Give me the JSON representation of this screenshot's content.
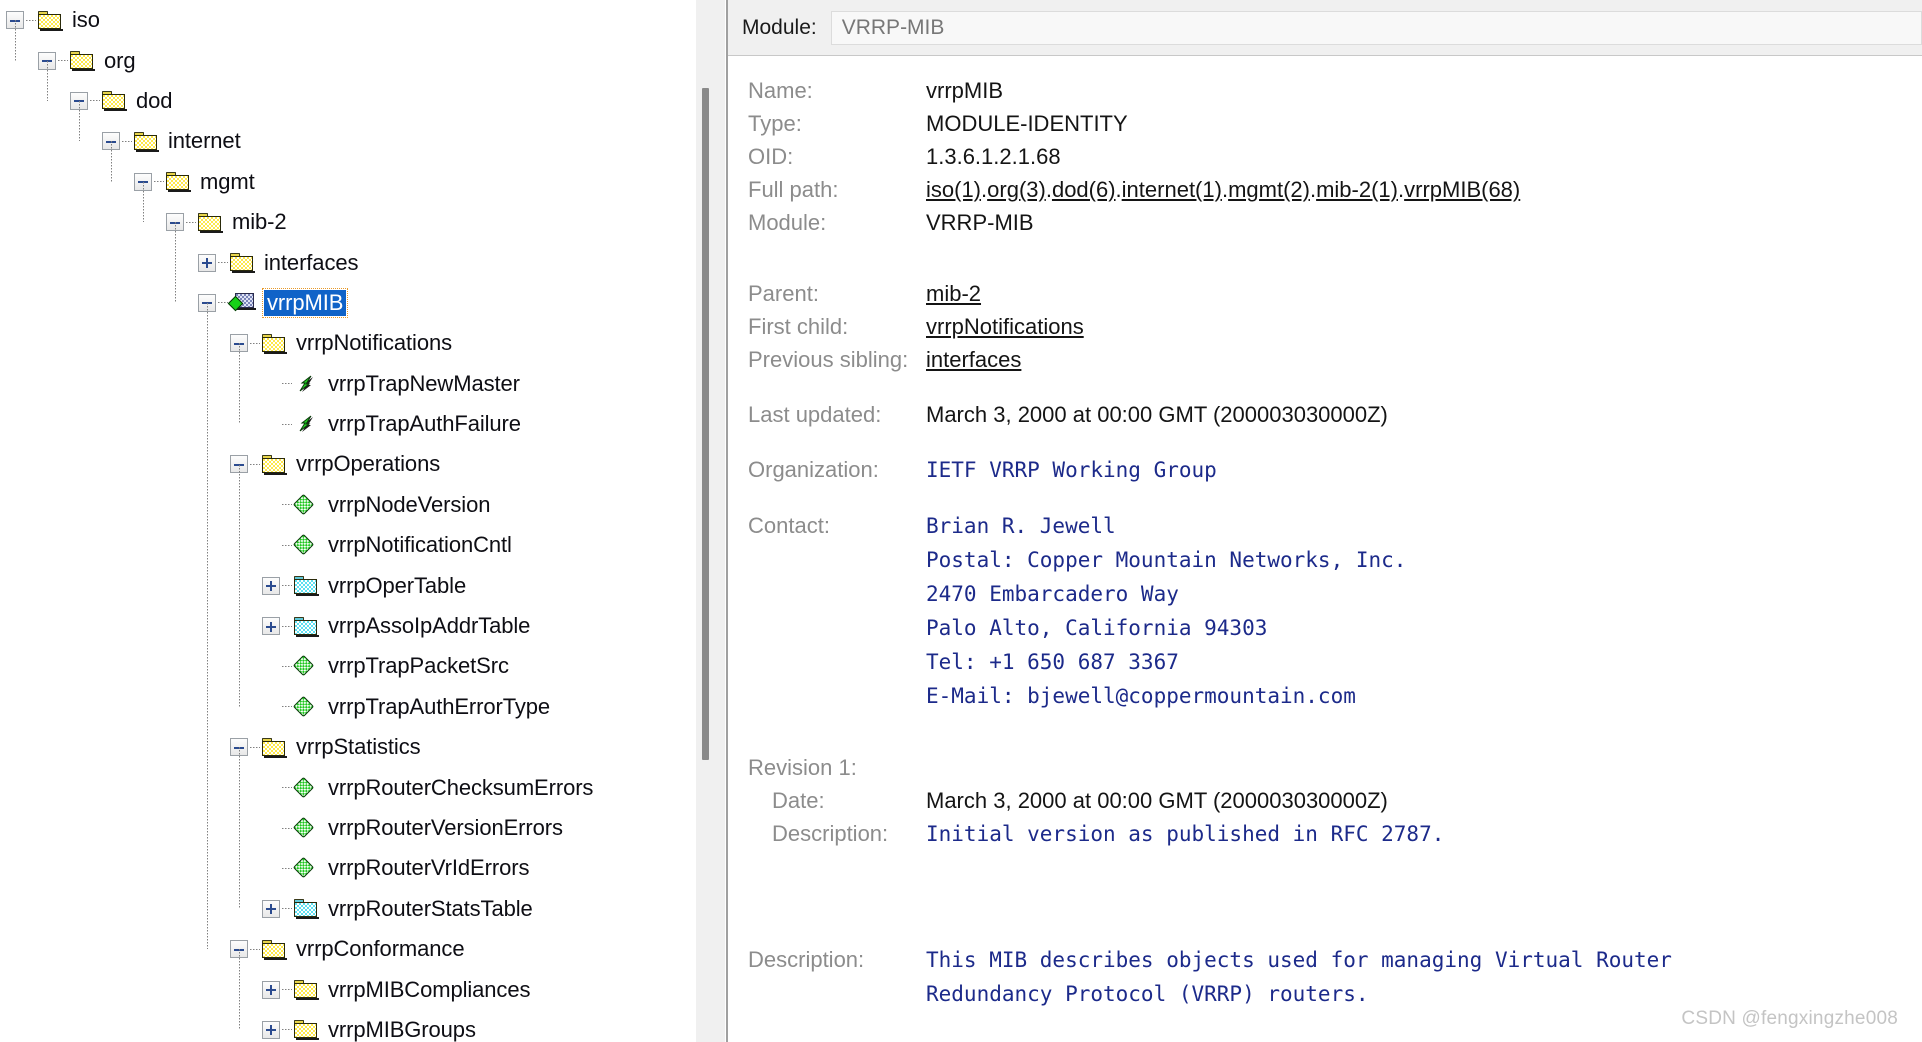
{
  "tree": {
    "nodes": [
      {
        "label": "iso",
        "depth": 0,
        "icon": "folder-yellow",
        "expander": "minus"
      },
      {
        "label": "org",
        "depth": 1,
        "icon": "folder-yellow",
        "expander": "minus"
      },
      {
        "label": "dod",
        "depth": 2,
        "icon": "folder-yellow",
        "expander": "minus"
      },
      {
        "label": "internet",
        "depth": 3,
        "icon": "folder-yellow",
        "expander": "minus"
      },
      {
        "label": "mgmt",
        "depth": 4,
        "icon": "folder-yellow",
        "expander": "minus"
      },
      {
        "label": "mib-2",
        "depth": 5,
        "icon": "folder-yellow",
        "expander": "minus"
      },
      {
        "label": "interfaces",
        "depth": 6,
        "icon": "folder-yellow",
        "expander": "plus"
      },
      {
        "label": "vrrpMIB",
        "depth": 6,
        "icon": "module",
        "expander": "minus",
        "selected": true
      },
      {
        "label": "vrrpNotifications",
        "depth": 7,
        "icon": "folder-yellow",
        "expander": "minus"
      },
      {
        "label": "vrrpTrapNewMaster",
        "depth": 8,
        "icon": "trap",
        "expander": "none"
      },
      {
        "label": "vrrpTrapAuthFailure",
        "depth": 8,
        "icon": "trap",
        "expander": "none"
      },
      {
        "label": "vrrpOperations",
        "depth": 7,
        "icon": "folder-yellow",
        "expander": "minus"
      },
      {
        "label": "vrrpNodeVersion",
        "depth": 8,
        "icon": "scalar",
        "expander": "none"
      },
      {
        "label": "vrrpNotificationCntl",
        "depth": 8,
        "icon": "scalar",
        "expander": "none"
      },
      {
        "label": "vrrpOperTable",
        "depth": 8,
        "icon": "folder-cyan",
        "expander": "plus"
      },
      {
        "label": "vrrpAssoIpAddrTable",
        "depth": 8,
        "icon": "folder-cyan",
        "expander": "plus"
      },
      {
        "label": "vrrpTrapPacketSrc",
        "depth": 8,
        "icon": "scalar",
        "expander": "none"
      },
      {
        "label": "vrrpTrapAuthErrorType",
        "depth": 8,
        "icon": "scalar",
        "expander": "none"
      },
      {
        "label": "vrrpStatistics",
        "depth": 7,
        "icon": "folder-yellow",
        "expander": "minus"
      },
      {
        "label": "vrrpRouterChecksumErrors",
        "depth": 8,
        "icon": "scalar",
        "expander": "none"
      },
      {
        "label": "vrrpRouterVersionErrors",
        "depth": 8,
        "icon": "scalar",
        "expander": "none"
      },
      {
        "label": "vrrpRouterVrIdErrors",
        "depth": 8,
        "icon": "scalar",
        "expander": "none"
      },
      {
        "label": "vrrpRouterStatsTable",
        "depth": 8,
        "icon": "folder-cyan",
        "expander": "plus"
      },
      {
        "label": "vrrpConformance",
        "depth": 7,
        "icon": "folder-yellow",
        "expander": "minus"
      },
      {
        "label": "vrrpMIBCompliances",
        "depth": 8,
        "icon": "folder-yellow",
        "expander": "plus"
      },
      {
        "label": "vrrpMIBGroups",
        "depth": 8,
        "icon": "folder-yellow",
        "expander": "plus"
      }
    ]
  },
  "detail": {
    "module_bar": {
      "label": "Module:",
      "value": "VRRP-MIB"
    },
    "labels": {
      "name": "Name:",
      "type": "Type:",
      "oid": "OID:",
      "full_path": "Full path:",
      "module": "Module:",
      "parent": "Parent:",
      "first_child": "First child:",
      "previous_sibling": "Previous sibling:",
      "last_updated": "Last updated:",
      "organization": "Organization:",
      "contact": "Contact:",
      "revision": "Revision 1:",
      "revision_date": "Date:",
      "revision_description": "Description:",
      "description": "Description:"
    },
    "values": {
      "name": "vrrpMIB",
      "type": "MODULE-IDENTITY",
      "oid": "1.3.6.1.2.1.68",
      "full_path_segments": [
        "iso(1)",
        ".",
        "org(3)",
        ".",
        "dod(6)",
        ".",
        "internet(1)",
        ".",
        "mgmt(2)",
        ".",
        "mib-2(1)",
        ".",
        "vrrpMIB(68)"
      ],
      "full_path_text": "iso(1).org(3).dod(6).internet(1).mgmt(2).mib-2(1).vrrpMIB(68)",
      "module": "VRRP-MIB",
      "parent": "mib-2",
      "first_child": "vrrpNotifications",
      "previous_sibling": "interfaces",
      "last_updated": "March 3, 2000 at 00:00 GMT (200003030000Z)",
      "organization": "IETF VRRP Working Group",
      "contact": "Brian R. Jewell\nPostal: Copper Mountain Networks, Inc.\n2470 Embarcadero Way\nPalo Alto, California 94303\nTel: +1 650 687 3367\nE-Mail: bjewell@coppermountain.com",
      "revision_date": "March 3, 2000 at 00:00 GMT (200003030000Z)",
      "revision_description": "Initial version as published in RFC 2787.",
      "description": "This MIB describes objects used for managing Virtual Router\nRedundancy Protocol (VRRP) routers."
    }
  },
  "watermark": "CSDN @fengxingzhe008",
  "colors": {
    "selection_blue": "#1063c8",
    "mono_text_blue": "#1c2a8a",
    "label_gray": "#8c8c8c",
    "folder_yellow": "#ffe94a",
    "folder_cyan": "#5fe0f0",
    "scalar_green": "#1ec81e",
    "panel_bg": "#f0f0f0"
  }
}
